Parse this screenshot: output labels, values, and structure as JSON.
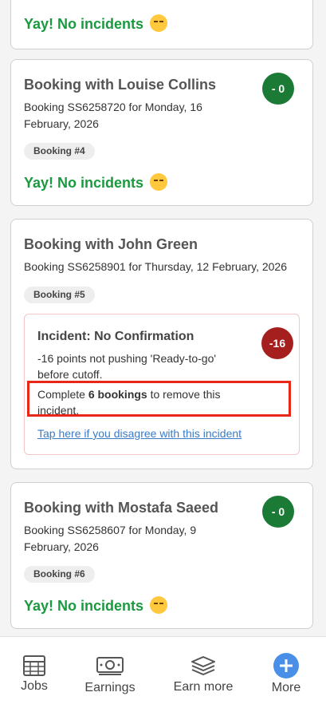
{
  "cards": [
    {
      "yay": "Yay! No incidents"
    },
    {
      "title": "Booking with Louise Collins",
      "subtitle": "Booking SS6258720 for Monday, 16 February, 2026",
      "badge": "Booking #4",
      "points": "- 0",
      "yay": "Yay! No incidents"
    },
    {
      "title": "Booking with John Green",
      "subtitle": "Booking SS6258901 for Thursday, 12 February, 2026",
      "badge": "Booking #5",
      "incident": {
        "title": "Incident: No Confirmation",
        "points": "-16",
        "description": "-16 points not pushing 'Ready-to-go' before cutoff.",
        "complete_prefix": "Complete ",
        "complete_bold": "6 bookings",
        "complete_suffix": " to remove this incident.",
        "link": "Tap here if you disagree with this incident"
      }
    },
    {
      "title": "Booking with Mostafa Saeed",
      "subtitle": "Booking SS6258607 for Monday, 9 February, 2026",
      "badge": "Booking #6",
      "points": "- 0",
      "yay": "Yay! No incidents"
    }
  ],
  "tabs": [
    {
      "label": "Jobs",
      "icon": "calendar-icon"
    },
    {
      "label": "Earnings",
      "icon": "cash-icon"
    },
    {
      "label": "Earn more",
      "icon": "stack-icon"
    },
    {
      "label": "More",
      "icon": "plus-circle-icon"
    }
  ],
  "colors": {
    "success": "#1a9a3f",
    "points_zero": "#1b7a35",
    "points_negative": "#a51f1f",
    "highlight": "#e8271a",
    "link": "#3a7bc8",
    "more_accent": "#4a8fe7"
  }
}
